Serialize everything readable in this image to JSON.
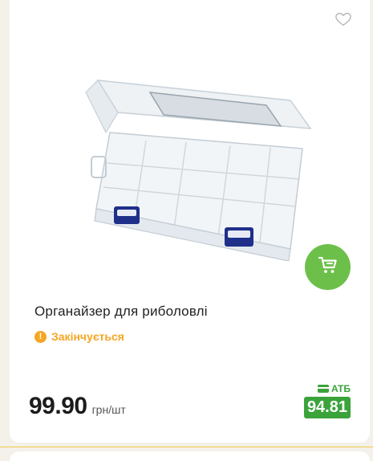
{
  "product": {
    "title": "Органайзер для риболовлі",
    "status": "Закінчується",
    "price": "99.90",
    "unit": "грн/шт",
    "club_label": "АТБ",
    "club_price": "94.81"
  },
  "icons": {
    "favorite": "heart-outline-icon",
    "cart": "cart-icon",
    "status": "exclamation-icon",
    "club": "card-icon"
  },
  "colors": {
    "accent_green": "#6cc04a",
    "club_green": "#3aa33a",
    "warning": "#f5a623",
    "background": "#f3f1e9"
  }
}
